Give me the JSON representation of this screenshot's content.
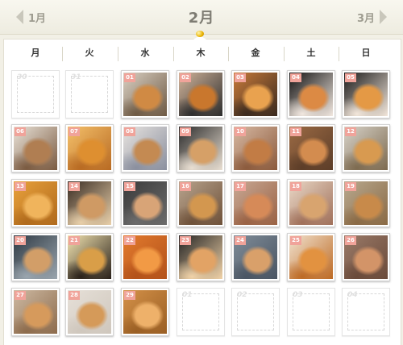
{
  "header": {
    "prev_label": "1月",
    "title": "2月",
    "next_label": "3月"
  },
  "weekdays": [
    "月",
    "火",
    "水",
    "木",
    "金",
    "土",
    "日"
  ],
  "cells": [
    {
      "day": "30",
      "type": "empty"
    },
    {
      "day": "31",
      "type": "empty"
    },
    {
      "day": "01",
      "type": "photo",
      "colors": [
        "#d9cfc2",
        "#d08a44",
        "#6e5a44"
      ]
    },
    {
      "day": "02",
      "type": "photo",
      "colors": [
        "#d2b49a",
        "#c9772d",
        "#2d2d2d"
      ]
    },
    {
      "day": "03",
      "type": "photo",
      "colors": [
        "#c77a3a",
        "#e9a24f",
        "#3a2a1f"
      ]
    },
    {
      "day": "04",
      "type": "photo",
      "colors": [
        "#111111",
        "#dc8a44",
        "#f1e7df"
      ]
    },
    {
      "day": "05",
      "type": "photo",
      "colors": [
        "#1a1a1a",
        "#e49945",
        "#f2e6da"
      ]
    },
    {
      "day": "06",
      "type": "photo",
      "colors": [
        "#e9e2d8",
        "#b07e52",
        "#7a5a40"
      ]
    },
    {
      "day": "07",
      "type": "photo",
      "colors": [
        "#f4c06a",
        "#de8f30",
        "#b86a22"
      ]
    },
    {
      "day": "08",
      "type": "photo",
      "colors": [
        "#e7e3df",
        "#c48a52",
        "#8a8f9e"
      ]
    },
    {
      "day": "09",
      "type": "photo",
      "colors": [
        "#2a2a2a",
        "#d6a067",
        "#e9dfd2"
      ]
    },
    {
      "day": "10",
      "type": "photo",
      "colors": [
        "#d7b8a2",
        "#c27c45",
        "#8b5a3c"
      ]
    },
    {
      "day": "11",
      "type": "photo",
      "colors": [
        "#9b6a44",
        "#d38c4f",
        "#5c3d28"
      ]
    },
    {
      "day": "12",
      "type": "photo",
      "colors": [
        "#d7d2c8",
        "#d89a50",
        "#7d6a4f"
      ]
    },
    {
      "day": "13",
      "type": "photo",
      "colors": [
        "#e8a13c",
        "#f0b45c",
        "#b06a1c"
      ]
    },
    {
      "day": "14",
      "type": "photo",
      "colors": [
        "#3a2d24",
        "#cf9a64",
        "#e8cfa9"
      ]
    },
    {
      "day": "15",
      "type": "photo",
      "colors": [
        "#3b3b3b",
        "#d8a477",
        "#6b6b6b"
      ]
    },
    {
      "day": "16",
      "type": "photo",
      "colors": [
        "#b8a38d",
        "#d3974f",
        "#6e5139"
      ]
    },
    {
      "day": "17",
      "type": "photo",
      "colors": [
        "#c8a894",
        "#d68a58",
        "#9a6244"
      ]
    },
    {
      "day": "18",
      "type": "photo",
      "colors": [
        "#e9d7c6",
        "#d8a46f",
        "#a0705a"
      ]
    },
    {
      "day": "19",
      "type": "photo",
      "colors": [
        "#b8a88e",
        "#c88a4a",
        "#8a6a45"
      ]
    },
    {
      "day": "20",
      "type": "photo",
      "colors": [
        "#2f3a44",
        "#d29e68",
        "#9aa5ae"
      ]
    },
    {
      "day": "21",
      "type": "photo",
      "colors": [
        "#f3e4b0",
        "#d99e48",
        "#2a211a"
      ]
    },
    {
      "day": "22",
      "type": "photo",
      "colors": [
        "#e27a2e",
        "#f29a45",
        "#b3521a"
      ]
    },
    {
      "day": "23",
      "type": "photo",
      "colors": [
        "#232323",
        "#e2a365",
        "#f0d2a8"
      ]
    },
    {
      "day": "24",
      "type": "photo",
      "colors": [
        "#7f8c98",
        "#d9a06a",
        "#4a5563"
      ]
    },
    {
      "day": "25",
      "type": "photo",
      "colors": [
        "#f1e2cf",
        "#e29240",
        "#bd6a24"
      ]
    },
    {
      "day": "26",
      "type": "photo",
      "colors": [
        "#9a7a68",
        "#d39468",
        "#6a4a3a"
      ]
    },
    {
      "day": "27",
      "type": "photo",
      "colors": [
        "#cdb9a2",
        "#d69a5c",
        "#8d6b4c"
      ]
    },
    {
      "day": "28",
      "type": "photo",
      "colors": [
        "#e6e0d8",
        "#d59a59",
        "#cfc7bd"
      ]
    },
    {
      "day": "29",
      "type": "photo",
      "colors": [
        "#d49148",
        "#eeb16a",
        "#9a5f24"
      ]
    },
    {
      "day": "01",
      "type": "empty"
    },
    {
      "day": "02",
      "type": "empty"
    },
    {
      "day": "03",
      "type": "empty"
    },
    {
      "day": "04",
      "type": "empty"
    }
  ]
}
